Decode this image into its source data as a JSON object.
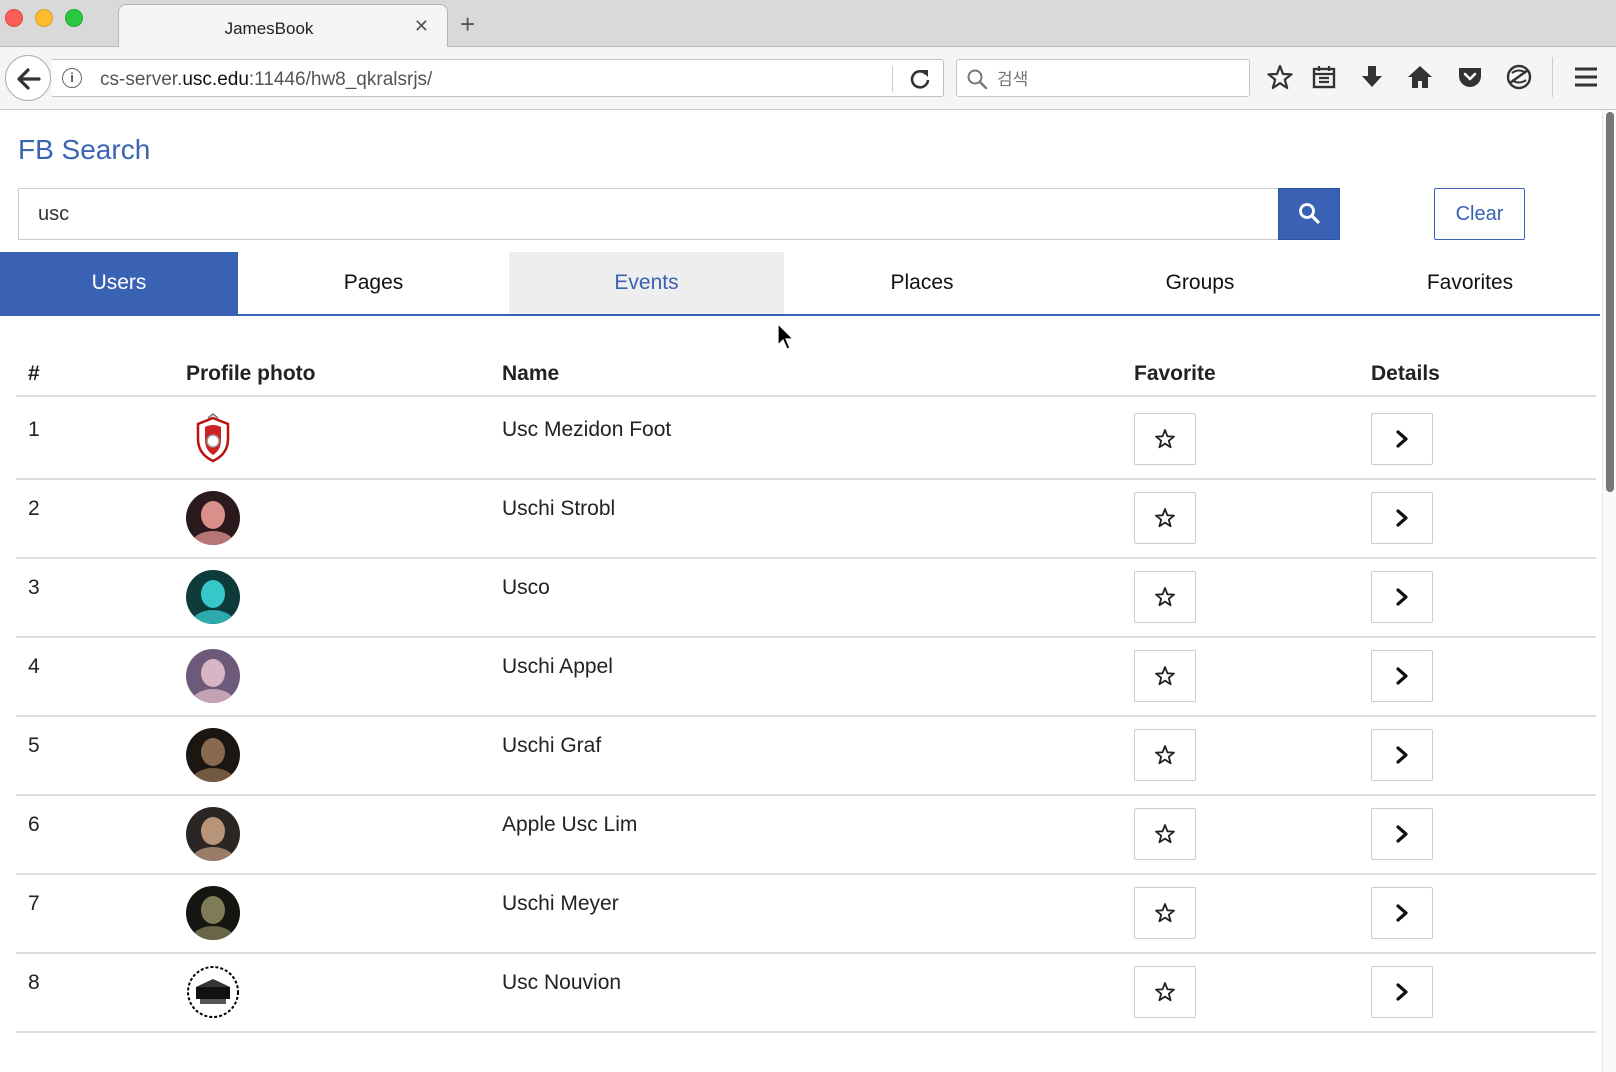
{
  "browser": {
    "tab_title": "JamesBook",
    "url_prefix": "cs-server.",
    "url_host": "usc.edu",
    "url_rest": ":11446/hw8_qkralsrjs/",
    "search_placeholder": "검색"
  },
  "app": {
    "title": "FB Search",
    "search_value": "usc",
    "clear_label": "Clear"
  },
  "tabs": [
    {
      "label": "Users",
      "state": "active"
    },
    {
      "label": "Pages",
      "state": "normal"
    },
    {
      "label": "Events",
      "state": "hover"
    },
    {
      "label": "Places",
      "state": "normal"
    },
    {
      "label": "Groups",
      "state": "normal"
    },
    {
      "label": "Favorites",
      "state": "normal"
    }
  ],
  "table": {
    "headers": [
      "#",
      "Profile photo",
      "Name",
      "Favorite",
      "Details"
    ],
    "rows": [
      {
        "num": "1",
        "name": "Usc Mezidon Foot",
        "avatar": "crest-logo"
      },
      {
        "num": "2",
        "name": "Uschi Strobl",
        "avatar": "profile-photo"
      },
      {
        "num": "3",
        "name": "Usco",
        "avatar": "profile-photo"
      },
      {
        "num": "4",
        "name": "Uschi Appel",
        "avatar": "profile-photo"
      },
      {
        "num": "5",
        "name": "Uschi Graf",
        "avatar": "profile-photo"
      },
      {
        "num": "6",
        "name": "Apple Usc Lim",
        "avatar": "profile-photo"
      },
      {
        "num": "7",
        "name": "Uschi Meyer",
        "avatar": "profile-photo"
      },
      {
        "num": "8",
        "name": "Usc Nouvion",
        "avatar": "bw-logo"
      }
    ]
  },
  "colors": {
    "accent": "#3a62b4",
    "border": "#dddddd"
  }
}
